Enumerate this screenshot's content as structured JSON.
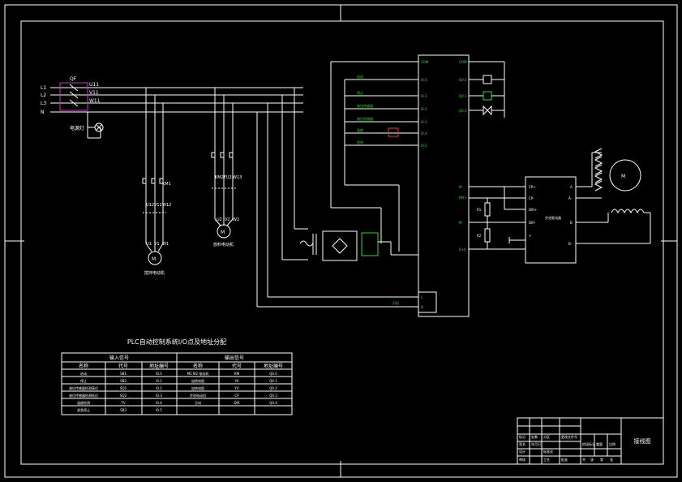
{
  "colors": {
    "background": "#000000",
    "line": "#ffffff",
    "accent_green": "#22dd22",
    "accent_magenta": "#cc33cc",
    "accent_red": "#ee3333"
  },
  "left_bus": {
    "phase_labels": [
      "L1",
      "L2",
      "L3",
      "N"
    ],
    "breaker_label": "QF",
    "breaker_terminals": [
      "U11",
      "V11",
      "W11"
    ],
    "indicator_label": "电源灯"
  },
  "motor_branches": [
    {
      "contactor_terms": [
        "KM1"
      ],
      "relay_terms": [
        "U12",
        "V12",
        "W12"
      ],
      "output_terms": [
        "U1",
        "V1",
        "W1"
      ],
      "motor_label": "M",
      "caption": "搅拌电动机"
    },
    {
      "contactor_terms": [
        "KM2",
        "FU2",
        "W13"
      ],
      "relay_terms": [
        "U13",
        "V13",
        "W13"
      ],
      "output_terms": [
        "U2",
        "V2",
        "W2"
      ],
      "motor_label": "M",
      "caption": "放料电动机"
    }
  ],
  "plc": {
    "common_in": "COM",
    "common_out": "COM",
    "inputs": [
      {
        "addr": "I0.0",
        "label": "启动"
      },
      {
        "addr": "I0.1",
        "label": "停止"
      },
      {
        "addr": "I0.2",
        "label": "液位传感器"
      },
      {
        "addr": "I0.3",
        "label": "液位传感器"
      },
      {
        "addr": "I0.4",
        "label": "温度"
      },
      {
        "addr": "I0.5",
        "label": "急停"
      }
    ],
    "outputs": [
      "Q0.0",
      "Q0.1",
      "Q0.2",
      "Q0.3"
    ],
    "analog": [
      "M",
      "PW+",
      "M",
      "0+A"
    ],
    "supply_terms": [
      "L",
      "N"
    ],
    "supply_label": "24V"
  },
  "heater_driver": {
    "terms_left": [
      "CP+",
      "CP-",
      "DIR+",
      "DIR-",
      "+"
    ],
    "terms_right": [
      "A",
      "A-",
      "B",
      "B-"
    ],
    "model": "步进驱动器",
    "resistors": [
      "R1",
      "R2"
    ]
  },
  "stepper_label": "M",
  "io_table": {
    "title": "PLC自动控制系统I/O点及地址分配",
    "input_header": "输入信号",
    "output_header": "输出信号",
    "col_headers": [
      "名称",
      "代号",
      "地址编号",
      "名称",
      "代号",
      "地址编号"
    ],
    "rows": [
      [
        "启动",
        "SB1",
        "I0.0",
        "M1 M2 电动机",
        "KM",
        "Q0.0"
      ],
      [
        "停止",
        "SB2",
        "I0.1",
        "加热电阻",
        "YA",
        "Q0.1"
      ],
      [
        "液位传感器检测高位",
        "SQ1",
        "I0.2",
        "加热电阻",
        "YV",
        "Q0.2"
      ],
      [
        "液位传感器检测低位",
        "SQ2",
        "I0.3",
        "步进电动机",
        "CP",
        "Q0.3"
      ],
      [
        "温度检测",
        "TV",
        "I0.4",
        "方向",
        "DIR",
        "Q0.4"
      ],
      [
        "紧急停止",
        "SB3",
        "I0.5",
        "",
        "",
        ""
      ]
    ]
  },
  "title_block": {
    "drawing_name": "接线图",
    "labels": [
      "标记",
      "处数",
      "分区",
      "更改文件号",
      "签名",
      "年月日",
      "设计",
      "标准化",
      "审核",
      "工艺",
      "批准",
      "阶段标记",
      "重量",
      "比例",
      "共",
      "张",
      "第",
      "张"
    ]
  }
}
